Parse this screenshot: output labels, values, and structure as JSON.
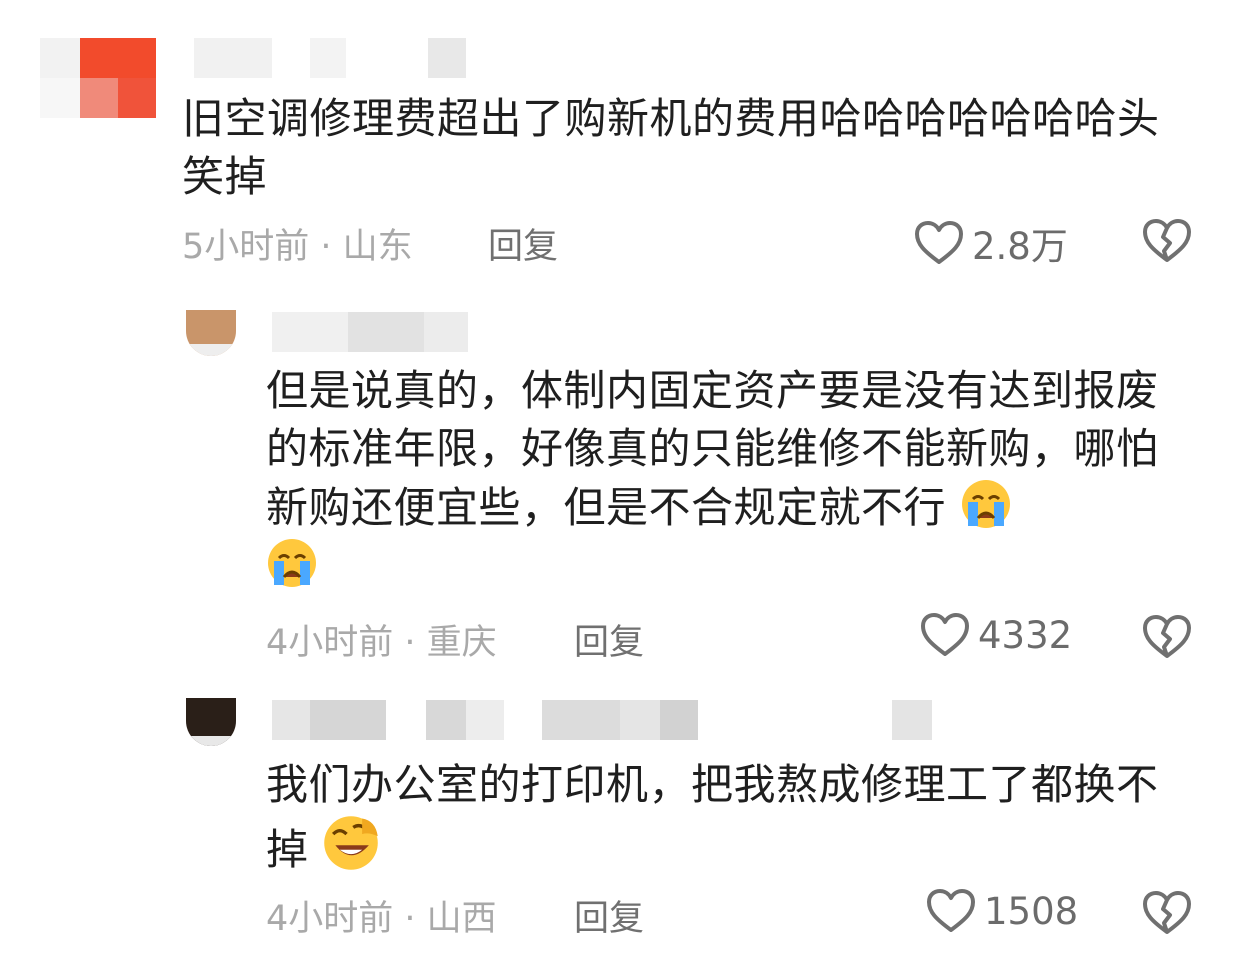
{
  "comments": [
    {
      "text": "旧空调修理费超出了购新机的费用哈哈哈哈哈哈哈头笑掉",
      "meta": "5小时前 · 山东",
      "reply": "回复",
      "likes": "2.8万"
    },
    {
      "text": "但是说真的，体制内固定资产要是没有达到报废的标准年限，好像真的只能维修不能新购，哪怕新购还便宜些，但是不合规定就不行",
      "meta": "4小时前 · 重庆",
      "reply": "回复",
      "likes": "4332",
      "emoji_names": [
        "crying-emoji",
        "crying-emoji"
      ]
    },
    {
      "text": "我们办公室的打印机，把我熬成修理工了都换不掉",
      "meta": "4小时前 · 山西",
      "reply": "回复",
      "likes": "1508",
      "emoji_names": [
        "rofl-emoji"
      ]
    }
  ],
  "icons": {
    "like": "heart-outline-icon",
    "dislike": "broken-heart-icon"
  },
  "colors": {
    "avatar1": "#f0533a",
    "text": "#1f1f1f",
    "meta": "#a9a9a9",
    "emoji": "#ffc83d",
    "tears": "#4aa8ff"
  }
}
